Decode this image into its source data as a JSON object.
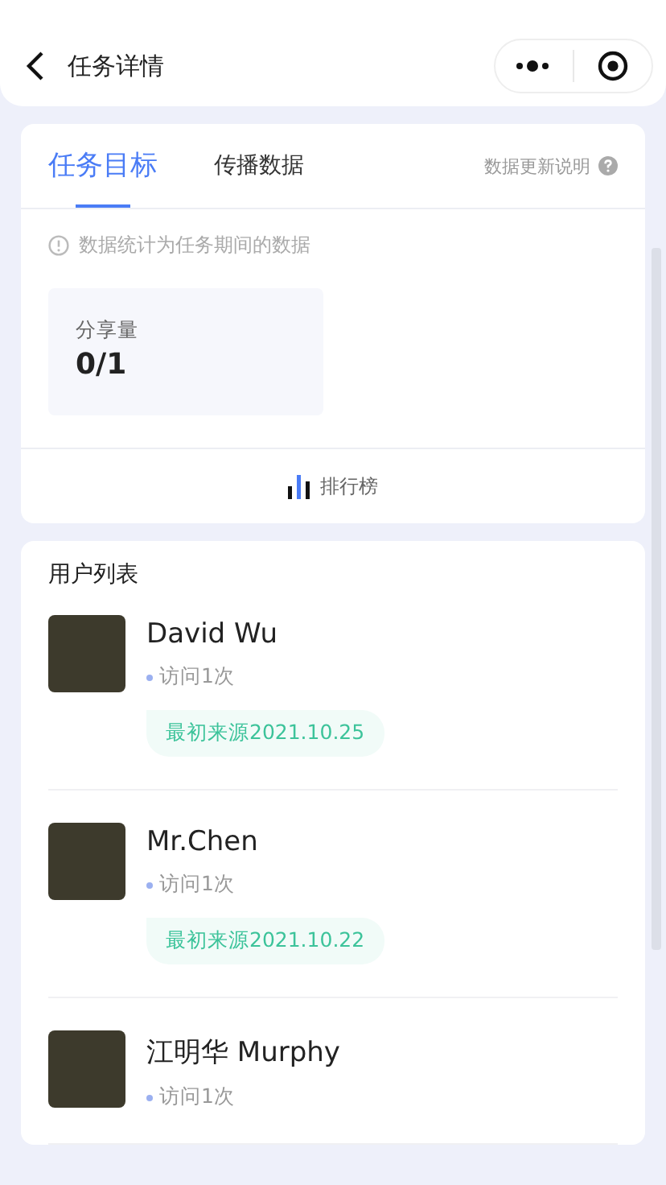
{
  "nav": {
    "title": "任务详情"
  },
  "tabs": [
    {
      "label": "任务目标",
      "selected": true
    },
    {
      "label": "传播数据",
      "selected": false
    }
  ],
  "update_note": "数据更新说明",
  "notice": "数据统计为任务期间的数据",
  "stat": {
    "label": "分享量",
    "value": "0/1"
  },
  "ranking": "排行榜",
  "user_list": {
    "title": "用户列表",
    "users": [
      {
        "name": "David Wu",
        "visits": "访问1次",
        "source": "最初来源2021.10.25"
      },
      {
        "name": "Mr.Chen",
        "visits": "访问1次",
        "source": "最初来源2021.10.22"
      },
      {
        "name": "江明华 Murphy",
        "visits": "访问1次"
      }
    ]
  }
}
